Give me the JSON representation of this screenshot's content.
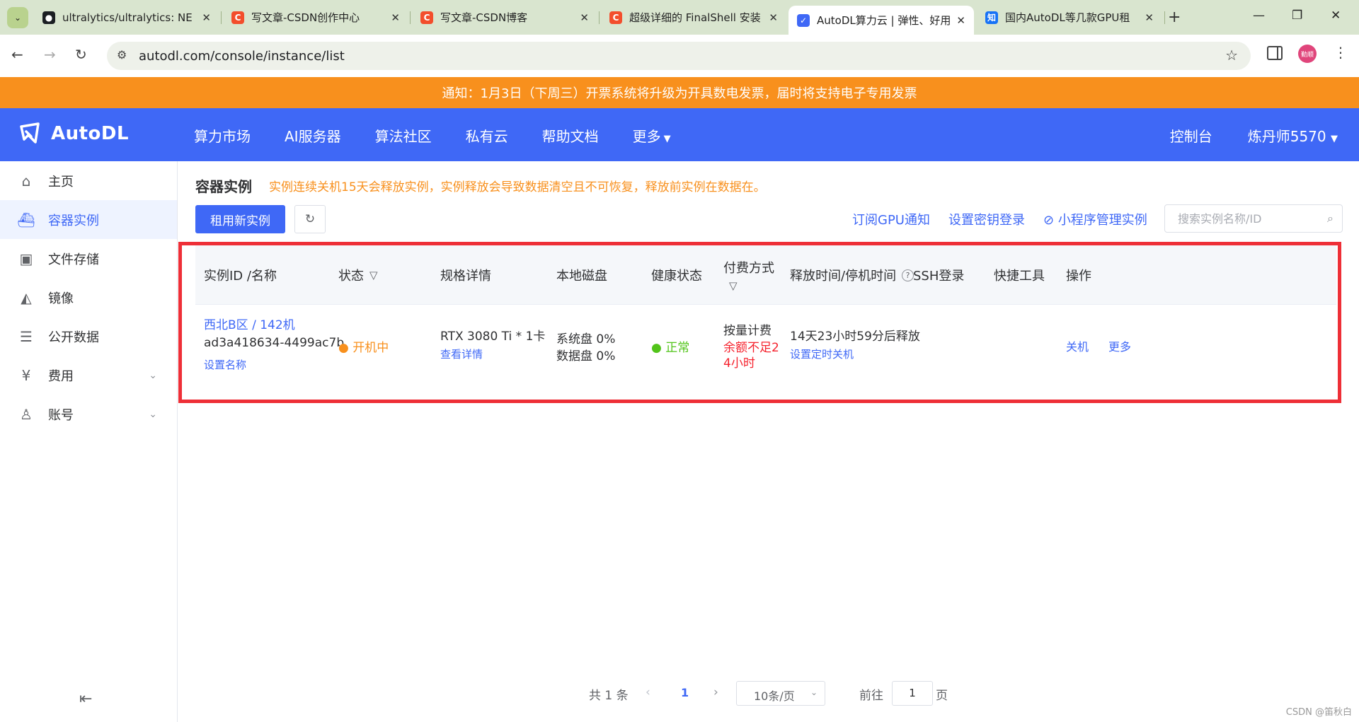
{
  "browser": {
    "tabs": [
      {
        "title": "ultralytics/ultralytics: NE",
        "favicon": "github-icon",
        "active": false
      },
      {
        "title": "写文章-CSDN创作中心",
        "favicon": "csdn-icon",
        "active": false
      },
      {
        "title": "写文章-CSDN博客",
        "favicon": "csdn-icon",
        "active": false
      },
      {
        "title": "超级详细的 FinalShell 安装",
        "favicon": "csdn-icon",
        "active": false
      },
      {
        "title": "AutoDL算力云 | 弹性、好用",
        "favicon": "autodl-icon",
        "active": true
      },
      {
        "title": "国内AutoDL等几款GPU租",
        "favicon": "zhihu-icon",
        "active": false
      }
    ],
    "url": "autodl.com/console/instance/list",
    "profile_label": "勤顺",
    "zhihu_glyph": "知"
  },
  "notice": "通知：1月3日（下周三）开票系统将升级为开具数电发票，届时将支持电子专用发票",
  "header": {
    "logo": "AutoDL",
    "nav": [
      "算力市场",
      "AI服务器",
      "算法社区",
      "私有云",
      "帮助文档",
      "更多"
    ],
    "console": "控制台",
    "user": "炼丹师5570"
  },
  "sidebar": {
    "items": [
      {
        "label": "主页",
        "icon": "home-icon"
      },
      {
        "label": "容器实例",
        "icon": "container-icon",
        "active": true
      },
      {
        "label": "文件存储",
        "icon": "storage-icon"
      },
      {
        "label": "镜像",
        "icon": "image-icon"
      },
      {
        "label": "公开数据",
        "icon": "database-icon"
      },
      {
        "label": "费用",
        "icon": "yen-icon",
        "expandable": true
      },
      {
        "label": "账号",
        "icon": "user-icon",
        "expandable": true
      }
    ]
  },
  "page": {
    "title": "容器实例",
    "warning": "实例连续关机15天会释放实例，实例释放会导致数据清空且不可恢复，释放前实例在数据在。",
    "new_button": "租用新实例",
    "links": [
      "订阅GPU通知",
      "设置密钥登录",
      "小程序管理实例"
    ],
    "search_placeholder": "搜索实例名称/ID"
  },
  "table": {
    "headers": [
      "实例ID /名称",
      "状态",
      "规格详情",
      "本地磁盘",
      "健康状态",
      "付费方式",
      "释放时间/停机时间",
      "SSH登录",
      "快捷工具",
      "操作"
    ],
    "row": {
      "name": "西北B区 / 142机",
      "id": "ad3a418634-4499ac7b",
      "set_name": "设置名称",
      "status": "开机中",
      "spec": "RTX 3080 Ti * 1卡",
      "spec_detail": "查看详情",
      "disk_system": "系统盘 0%",
      "disk_data": "数据盘 0%",
      "health": "正常",
      "billing": "按量计费",
      "billing_warn_1": "余额不足2",
      "billing_warn_2": "4小时",
      "release": "14天23小时59分后释放",
      "set_shutdown": "设置定时关机",
      "action_shutdown": "关机",
      "action_more": "更多"
    }
  },
  "pager": {
    "total": "共 1 条",
    "current": "1",
    "page_size": "10条/页",
    "goto": "前往",
    "goto_value": "1",
    "page_unit": "页"
  },
  "watermark": "CSDN @笛秋白",
  "colors": {
    "primary": "#3f68f6",
    "notice": "#f8901d",
    "highlight": "#ee2f37"
  }
}
